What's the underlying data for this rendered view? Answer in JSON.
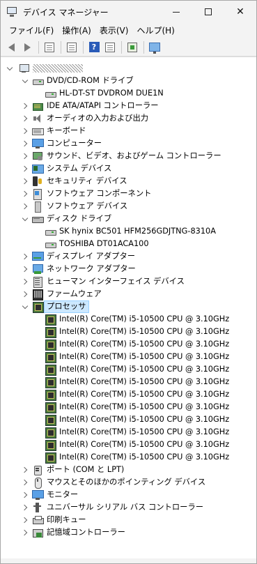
{
  "window": {
    "title": "デバイス マネージャー"
  },
  "menu": [
    {
      "label": "ファイル(F)"
    },
    {
      "label": "操作(A)"
    },
    {
      "label": "表示(V)"
    },
    {
      "label": "ヘルプ(H)"
    }
  ],
  "tree": {
    "root_label": "",
    "categories": [
      {
        "label": "DVD/CD-ROM ドライブ",
        "icon": "dvd-drive-icon",
        "expanded": true,
        "children": [
          "HL-DT-ST DVDROM DUE1N"
        ]
      },
      {
        "label": "IDE ATA/ATAPI コントローラー",
        "icon": "ide-controller-icon",
        "expanded": false
      },
      {
        "label": "オーディオの入力および出力",
        "icon": "speaker-icon",
        "expanded": false
      },
      {
        "label": "キーボード",
        "icon": "keyboard-icon",
        "expanded": false
      },
      {
        "label": "コンピューター",
        "icon": "computer-icon",
        "expanded": false
      },
      {
        "label": "サウンド、ビデオ、およびゲーム コントローラー",
        "icon": "game-controller-icon",
        "expanded": false
      },
      {
        "label": "システム デバイス",
        "icon": "system-devices-icon",
        "expanded": false
      },
      {
        "label": "セキュリティ デバイス",
        "icon": "security-device-icon",
        "expanded": false
      },
      {
        "label": "ソフトウェア コンポーネント",
        "icon": "software-component-icon",
        "expanded": false
      },
      {
        "label": "ソフトウェア デバイス",
        "icon": "software-device-icon",
        "expanded": false
      },
      {
        "label": "ディスク ドライブ",
        "icon": "disk-drive-icon",
        "expanded": true,
        "children": [
          "SK hynix BC501 HFM256GDJTNG-8310A",
          "TOSHIBA DT01ACA100"
        ]
      },
      {
        "label": "ディスプレイ アダプター",
        "icon": "display-adapter-icon",
        "expanded": false
      },
      {
        "label": "ネットワーク アダプター",
        "icon": "network-adapter-icon",
        "expanded": false
      },
      {
        "label": "ヒューマン インターフェイス デバイス",
        "icon": "hid-icon",
        "expanded": false
      },
      {
        "label": "ファームウェア",
        "icon": "firmware-icon",
        "expanded": false
      },
      {
        "label": "プロセッサ",
        "icon": "processor-icon",
        "expanded": true,
        "selected": true,
        "children": [
          "Intel(R) Core(TM) i5-10500 CPU @ 3.10GHz",
          "Intel(R) Core(TM) i5-10500 CPU @ 3.10GHz",
          "Intel(R) Core(TM) i5-10500 CPU @ 3.10GHz",
          "Intel(R) Core(TM) i5-10500 CPU @ 3.10GHz",
          "Intel(R) Core(TM) i5-10500 CPU @ 3.10GHz",
          "Intel(R) Core(TM) i5-10500 CPU @ 3.10GHz",
          "Intel(R) Core(TM) i5-10500 CPU @ 3.10GHz",
          "Intel(R) Core(TM) i5-10500 CPU @ 3.10GHz",
          "Intel(R) Core(TM) i5-10500 CPU @ 3.10GHz",
          "Intel(R) Core(TM) i5-10500 CPU @ 3.10GHz",
          "Intel(R) Core(TM) i5-10500 CPU @ 3.10GHz",
          "Intel(R) Core(TM) i5-10500 CPU @ 3.10GHz"
        ]
      },
      {
        "label": "ポート (COM と LPT)",
        "icon": "port-icon",
        "expanded": false
      },
      {
        "label": "マウスとそのほかのポインティング デバイス",
        "icon": "mouse-icon",
        "expanded": false
      },
      {
        "label": "モニター",
        "icon": "monitor-icon",
        "expanded": false
      },
      {
        "label": "ユニバーサル シリアル バス コントローラー",
        "icon": "usb-icon",
        "expanded": false
      },
      {
        "label": "印刷キュー",
        "icon": "print-queue-icon",
        "expanded": false
      },
      {
        "label": "記憶域コントローラー",
        "icon": "storage-controller-icon",
        "expanded": false
      }
    ]
  }
}
